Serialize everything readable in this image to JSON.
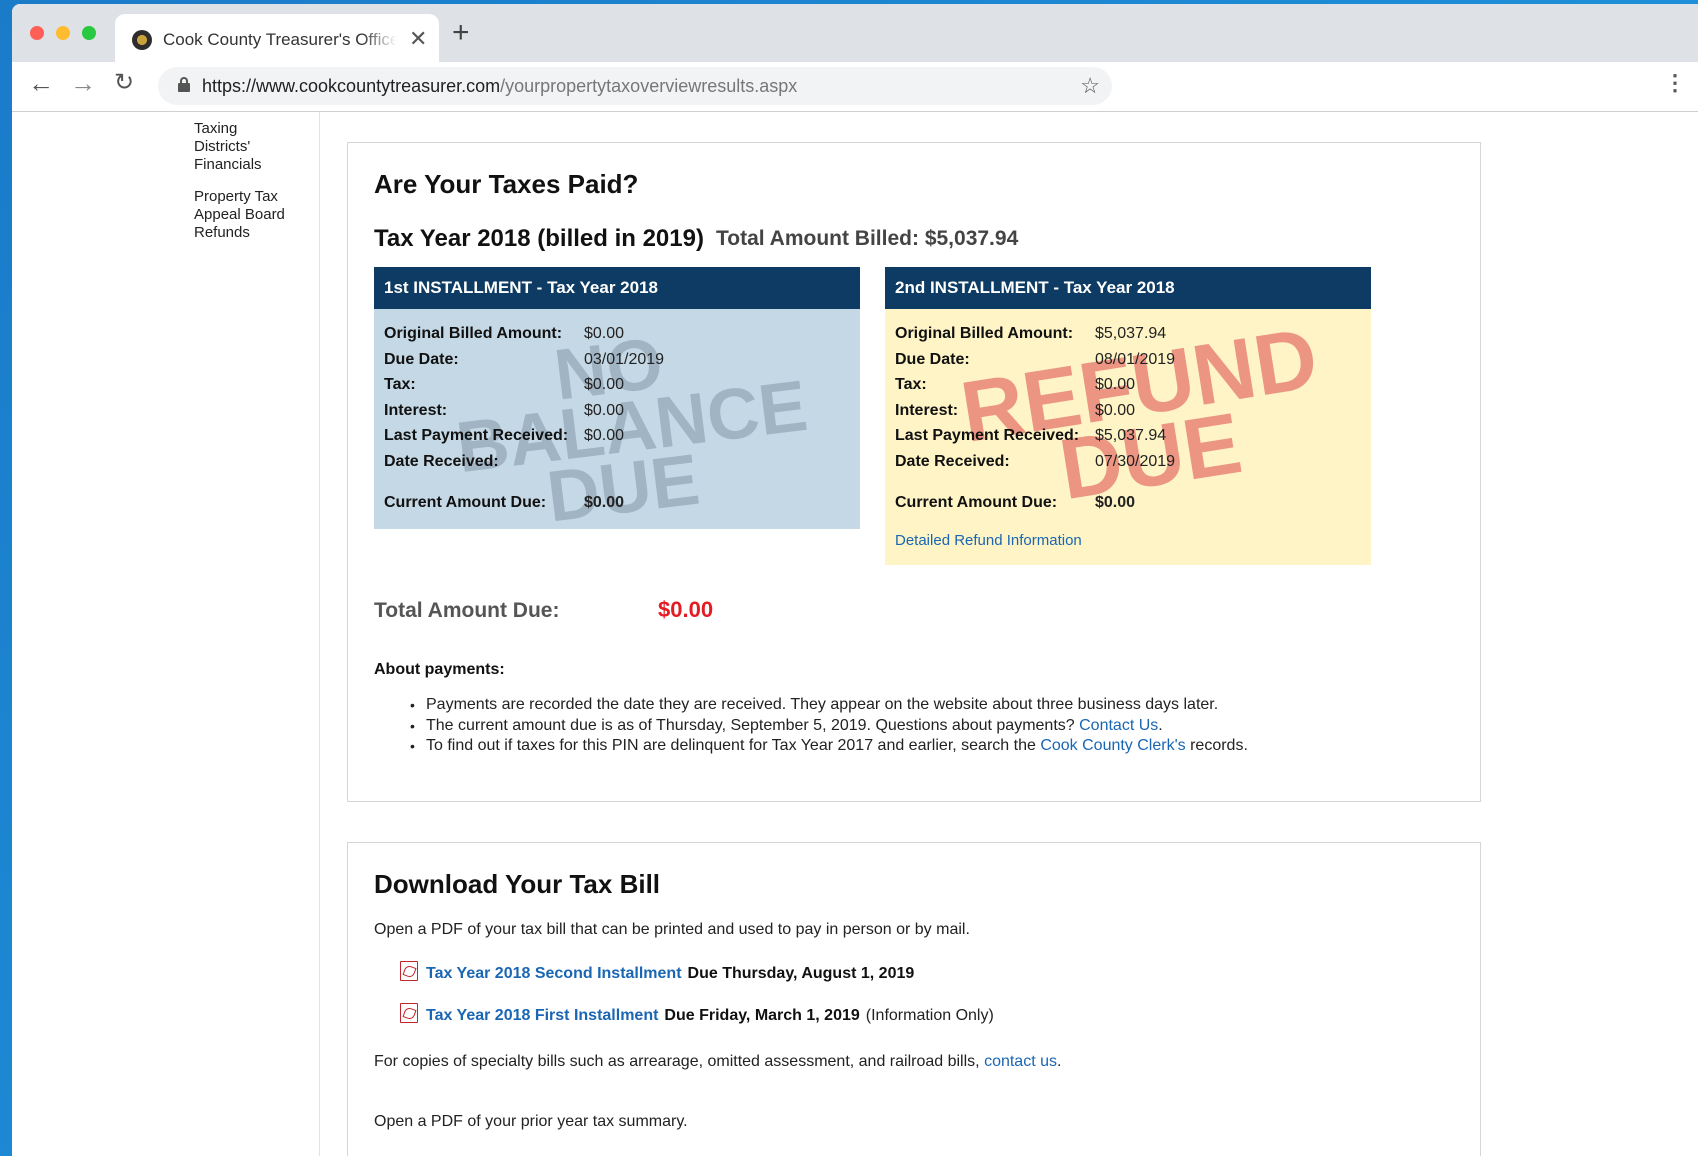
{
  "browser": {
    "tab_title": "Cook County Treasurer's Office",
    "tab_close": "✕",
    "new_tab": "+",
    "url_host": "https://www.cookcountytreasurer.com",
    "url_path": "/yourpropertytaxoverviewresults.aspx"
  },
  "sidebar": {
    "items": [
      {
        "label_lines": [
          "Taxing",
          "Districts'",
          "Financials"
        ]
      },
      {
        "label_lines": [
          "Property Tax",
          "Appeal Board",
          "Refunds"
        ]
      }
    ]
  },
  "taxes_paid": {
    "title": "Are Your Taxes Paid?",
    "tax_year": "Tax Year 2018 (billed in 2019)",
    "total_billed_label": "Total Amount Billed:",
    "total_billed_value": "$5,037.94",
    "installment1": {
      "header": "1st INSTALLMENT - Tax Year 2018",
      "stamp": "NO BALANCE DUE",
      "rows": [
        {
          "label": "Original Billed Amount:",
          "value": "$0.00"
        },
        {
          "label": "Due Date:",
          "value": "03/01/2019"
        },
        {
          "label": "Tax:",
          "value": "$0.00"
        },
        {
          "label": "Interest:",
          "value": "$0.00"
        },
        {
          "label": "Last Payment Received:",
          "value": "$0.00"
        },
        {
          "label": "Date Received:",
          "value": ""
        }
      ],
      "current_due_label": "Current Amount Due:",
      "current_due_value": "$0.00",
      "bg_color": "#c5d8e5"
    },
    "installment2": {
      "header": "2nd INSTALLMENT - Tax Year 2018",
      "stamp": "REFUND DUE",
      "rows": [
        {
          "label": "Original Billed Amount:",
          "value": "$5,037.94"
        },
        {
          "label": "Due Date:",
          "value": "08/01/2019"
        },
        {
          "label": "Tax:",
          "value": "$0.00"
        },
        {
          "label": "Interest:",
          "value": "$0.00"
        },
        {
          "label": "Last Payment Received:",
          "value": "$5,037.94"
        },
        {
          "label": "Date Received:",
          "value": "07/30/2019"
        }
      ],
      "current_due_label": "Current Amount Due:",
      "current_due_value": "$0.00",
      "refund_link": "Detailed Refund Information",
      "bg_color": "#fef4c6"
    },
    "header_color": "#0d3b63",
    "total_due_label": "Total Amount Due:",
    "total_due_value": "$0.00",
    "total_due_color": "#e31b23",
    "about_heading": "About payments:",
    "about_items": {
      "i1": "Payments are recorded the date they are received. They appear on the website about three business days later.",
      "i2_text": "The current amount due is as of Thursday, September 5, 2019. Questions about payments? ",
      "i2_link": "Contact Us",
      "i2_end": ".",
      "i3_text": "To find out if taxes for this PIN are delinquent for Tax Year 2017 and earlier, search the ",
      "i3_link": "Cook County Clerk's",
      "i3_end": " records."
    }
  },
  "download": {
    "title": "Download Your Tax Bill",
    "intro": "Open a PDF of your tax bill that can be printed and used to pay in person or by mail.",
    "bills": [
      {
        "link": "Tax Year 2018 Second Installment",
        "due": "Due Thursday, August 1, 2019",
        "note": ""
      },
      {
        "link": "Tax Year 2018 First Installment",
        "due": "Due Friday, March 1, 2019",
        "note": "(Information Only)"
      }
    ],
    "specialty_text": "For copies of specialty bills such as arrearage, omitted assessment, and railroad bills, ",
    "specialty_link": "contact us",
    "specialty_end": ".",
    "prior_text": "Open a PDF of your prior year tax summary."
  }
}
